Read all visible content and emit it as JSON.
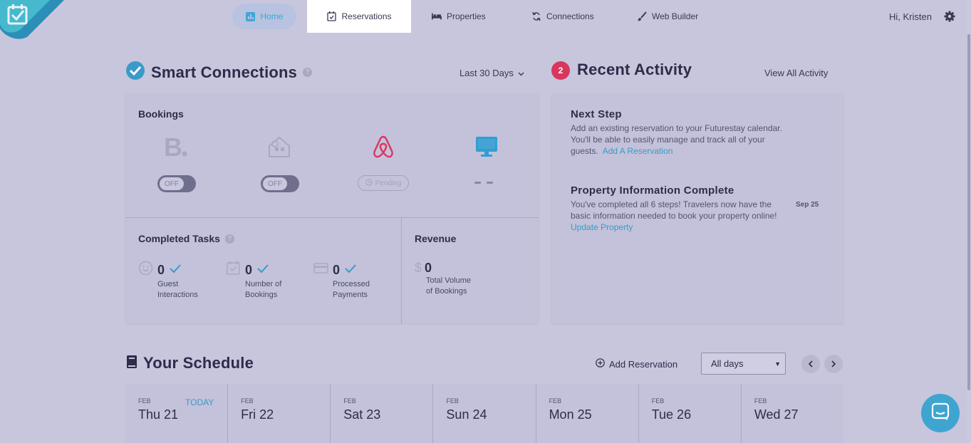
{
  "nav": {
    "items": [
      {
        "label": "Home",
        "icon": "chart-icon"
      },
      {
        "label": "Reservations",
        "icon": "calendar-check-icon"
      },
      {
        "label": "Properties",
        "icon": "bed-icon"
      },
      {
        "label": "Connections",
        "icon": "sync-icon"
      },
      {
        "label": "Web Builder",
        "icon": "brush-icon"
      }
    ],
    "active": "Reservations",
    "greeting": "Hi, Kristen"
  },
  "smart": {
    "title": "Smart Connections",
    "help": "?",
    "period": "Last 30 Days",
    "bookings_title": "Bookings",
    "channels": [
      {
        "name": "booking-com",
        "status": "OFF"
      },
      {
        "name": "homeaway",
        "status": "OFF"
      },
      {
        "name": "airbnb",
        "status": "Pending"
      },
      {
        "name": "website",
        "status": "- -"
      }
    ],
    "tasks_title": "Completed Tasks",
    "tasks": [
      {
        "value": "0",
        "label_1": "Guest",
        "label_2": "Interactions"
      },
      {
        "value": "0",
        "label_1": "Number of",
        "label_2": "Bookings"
      },
      {
        "value": "0",
        "label_1": "Processed",
        "label_2": "Payments"
      }
    ],
    "revenue_title": "Revenue",
    "revenue": {
      "symbol": "$",
      "value": "0",
      "label_1": "Total Volume",
      "label_2": "of Bookings"
    }
  },
  "recent": {
    "badge": "2",
    "title": "Recent Activity",
    "view_all": "View All Activity",
    "items": [
      {
        "title": "Next Step",
        "text": "Add an existing reservation to your Futurestay calendar. You'll be able to easily manage and track all of your guests.",
        "link": "Add A Reservation"
      },
      {
        "title": "Property Information Complete",
        "text": "You've completed all 6 steps! Travelers now have the basic information needed to book your property online!",
        "link": "Update Property",
        "date": "Sep 25"
      }
    ]
  },
  "schedule": {
    "title": "Your Schedule",
    "add_label": "Add Reservation",
    "filter": "All days",
    "today_label": "TODAY",
    "days": [
      {
        "month": "FEB",
        "name": "Thu 21"
      },
      {
        "month": "FEB",
        "name": "Fri 22"
      },
      {
        "month": "FEB",
        "name": "Sat 23"
      },
      {
        "month": "FEB",
        "name": "Sun 24"
      },
      {
        "month": "FEB",
        "name": "Mon 25"
      },
      {
        "month": "FEB",
        "name": "Tue 26"
      },
      {
        "month": "FEB",
        "name": "Wed 27"
      }
    ]
  },
  "colors": {
    "accent": "#3ea7d8",
    "badge": "#d9365e",
    "airbnb": "#d9365e",
    "background": "#c7c6dd"
  }
}
